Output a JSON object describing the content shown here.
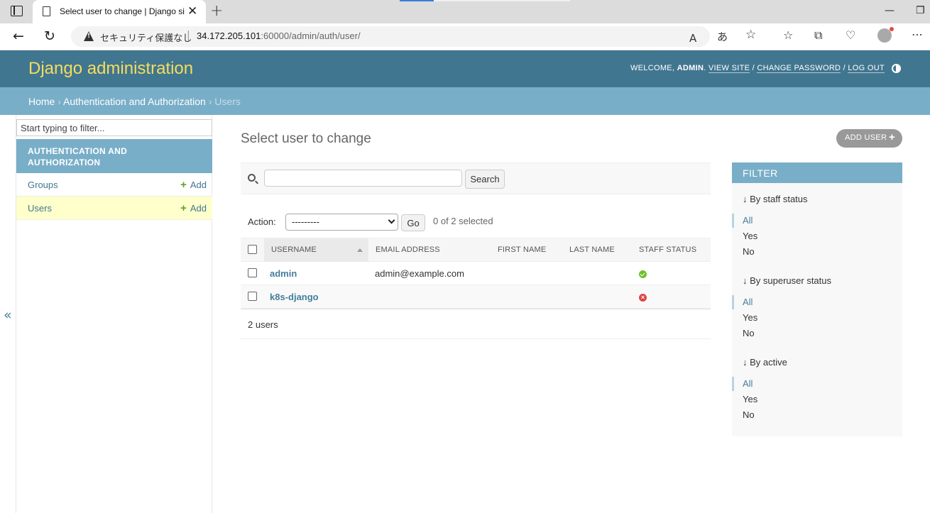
{
  "browser": {
    "tab_title": "Select user to change | Django site admin",
    "url_security": "セキュリティ保護なし",
    "url_host": "34.172.205.101",
    "url_port": ":60000",
    "url_path": "/admin/auth/user/"
  },
  "header": {
    "branding": "Django administration",
    "welcome": "WELCOME,",
    "username": "ADMIN",
    "view_site": "VIEW SITE",
    "change_password": "CHANGE PASSWORD",
    "log_out": "LOG OUT"
  },
  "breadcrumbs": {
    "home": "Home",
    "app": "Authentication and Authorization",
    "current": "Users"
  },
  "sidebar": {
    "filter_placeholder": "Start typing to filter...",
    "app_caption": "AUTHENTICATION AND AUTHORIZATION",
    "models": [
      {
        "name": "Groups",
        "add": "Add"
      },
      {
        "name": "Users",
        "add": "Add"
      }
    ],
    "collapse": "«"
  },
  "content": {
    "title": "Select user to change",
    "add_button": "ADD USER",
    "search_button": "Search",
    "action_label": "Action:",
    "action_selected": "---------",
    "go_button": "Go",
    "selected_count": "0 of 2 selected",
    "columns": [
      "USERNAME",
      "EMAIL ADDRESS",
      "FIRST NAME",
      "LAST NAME",
      "STAFF STATUS"
    ],
    "rows": [
      {
        "username": "admin",
        "email": "admin@example.com",
        "first_name": "",
        "last_name": "",
        "staff": true
      },
      {
        "username": "k8s-django",
        "email": "",
        "first_name": "",
        "last_name": "",
        "staff": false
      }
    ],
    "paginator": "2 users"
  },
  "filter": {
    "title": "FILTER",
    "groups": [
      {
        "heading": "↓ By staff status",
        "options": [
          "All",
          "Yes",
          "No"
        ]
      },
      {
        "heading": "↓ By superuser status",
        "options": [
          "All",
          "Yes",
          "No"
        ]
      },
      {
        "heading": "↓ By active",
        "options": [
          "All",
          "Yes",
          "No"
        ]
      }
    ]
  },
  "colors": {
    "header_bg": "#417690",
    "branding": "#f5dd5d",
    "breadcrumbs_bg": "#79aec8",
    "link": "#447e9b",
    "current_row": "#ffffcc",
    "add_green": "#5fa225"
  }
}
